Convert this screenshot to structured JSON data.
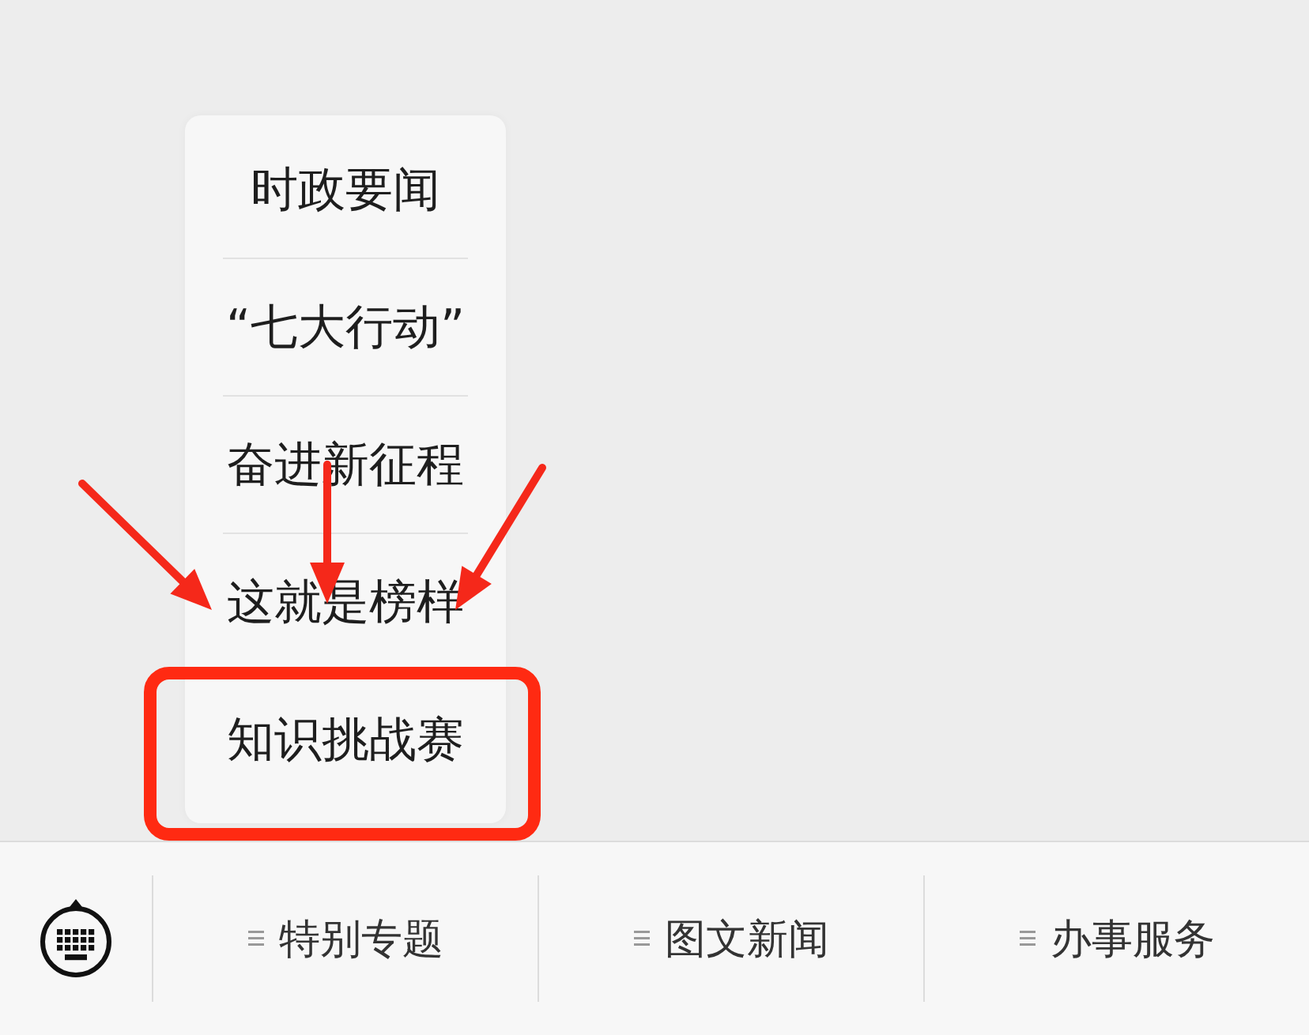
{
  "menu": {
    "items": [
      {
        "label": "时政要闻",
        "highlighted": false
      },
      {
        "label": "“七大行动”",
        "highlighted": false
      },
      {
        "label": "奋进新征程",
        "highlighted": false
      },
      {
        "label": "这就是榜样",
        "highlighted": false
      },
      {
        "label": "知识挑战赛",
        "highlighted": true
      }
    ]
  },
  "bottom_bar": {
    "tabs": [
      {
        "label": "特别专题",
        "selected": false
      },
      {
        "label": "图文新闻",
        "selected": false
      },
      {
        "label": "办事服务",
        "selected": false
      }
    ]
  }
}
